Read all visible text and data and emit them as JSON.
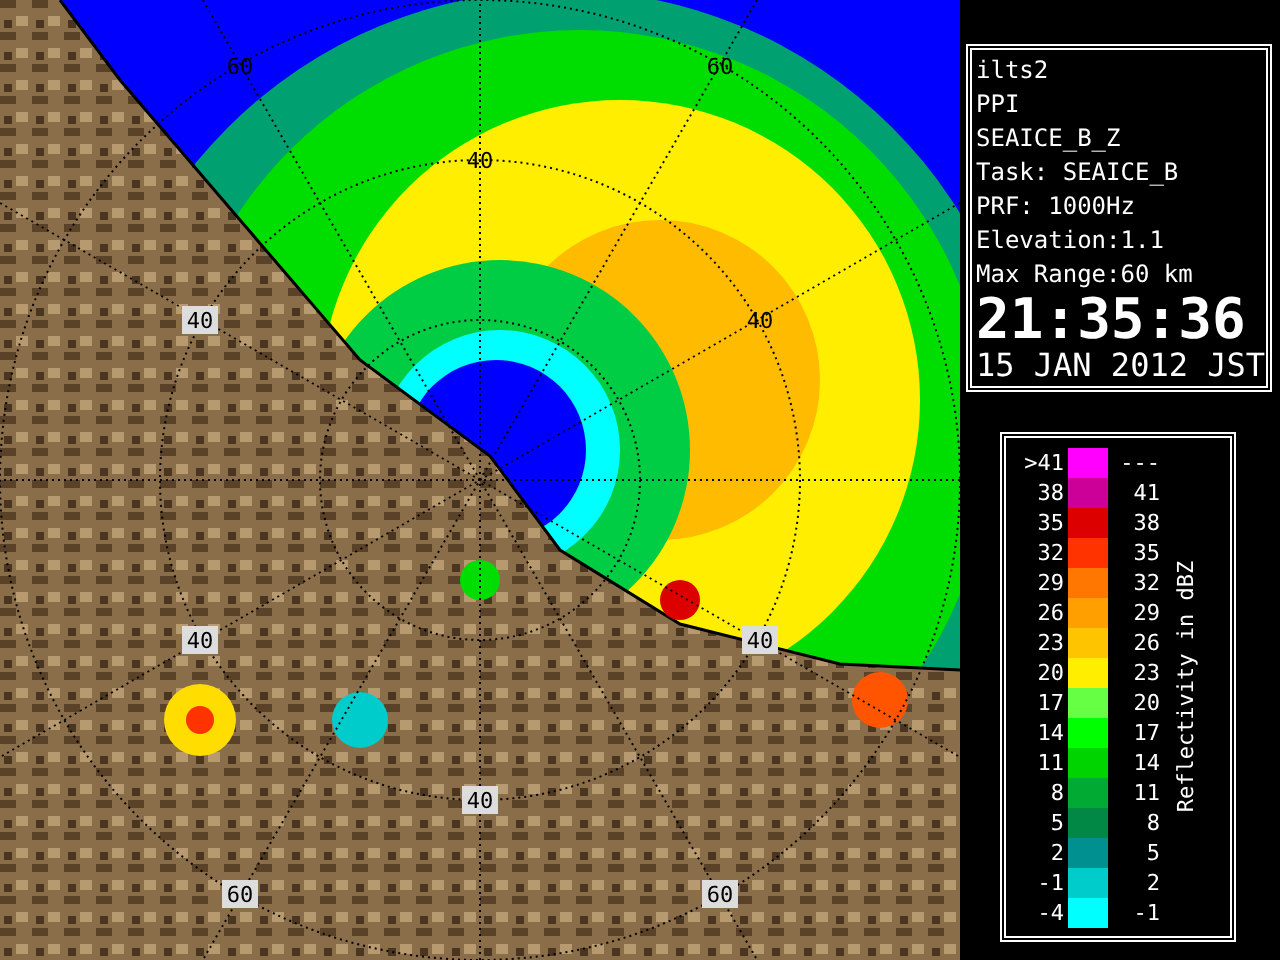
{
  "radar_map": {
    "ring_labels": [
      "60",
      "60",
      "40",
      "40",
      "40",
      "40",
      "40",
      "40",
      "60",
      "60"
    ]
  },
  "info_panel": {
    "lines": [
      "ilts2",
      "PPI",
      "SEAICE_B_Z",
      "Task: SEAICE_B",
      "PRF: 1000Hz",
      "Elevation:1.1",
      "Max Range:60 km"
    ],
    "time": "21:35:36",
    "date": "15 JAN 2012 JST"
  },
  "legend": {
    "title": "Reflectivity in dBZ",
    "rows": [
      {
        "low": ">41",
        "high": "---",
        "color": "#ff00ff"
      },
      {
        "low": "38",
        "high": "41",
        "color": "#cc0099"
      },
      {
        "low": "35",
        "high": "38",
        "color": "#dd0000"
      },
      {
        "low": "32",
        "high": "35",
        "color": "#ff3300"
      },
      {
        "low": "29",
        "high": "32",
        "color": "#ff7700"
      },
      {
        "low": "26",
        "high": "29",
        "color": "#ffa000"
      },
      {
        "low": "23",
        "high": "26",
        "color": "#ffc400"
      },
      {
        "low": "20",
        "high": "23",
        "color": "#ffee00"
      },
      {
        "low": "17",
        "high": "20",
        "color": "#66ff44"
      },
      {
        "low": "14",
        "high": "17",
        "color": "#00ff00"
      },
      {
        "low": "11",
        "high": "14",
        "color": "#00d400"
      },
      {
        "low": "8",
        "high": "11",
        "color": "#00aa33"
      },
      {
        "low": "5",
        "high": "8",
        "color": "#008844"
      },
      {
        "low": "2",
        "high": "5",
        "color": "#009090"
      },
      {
        "low": "-1",
        "high": "2",
        "color": "#00cccc"
      },
      {
        "low": "-4",
        "high": "-1",
        "color": "#00ffff"
      }
    ]
  }
}
